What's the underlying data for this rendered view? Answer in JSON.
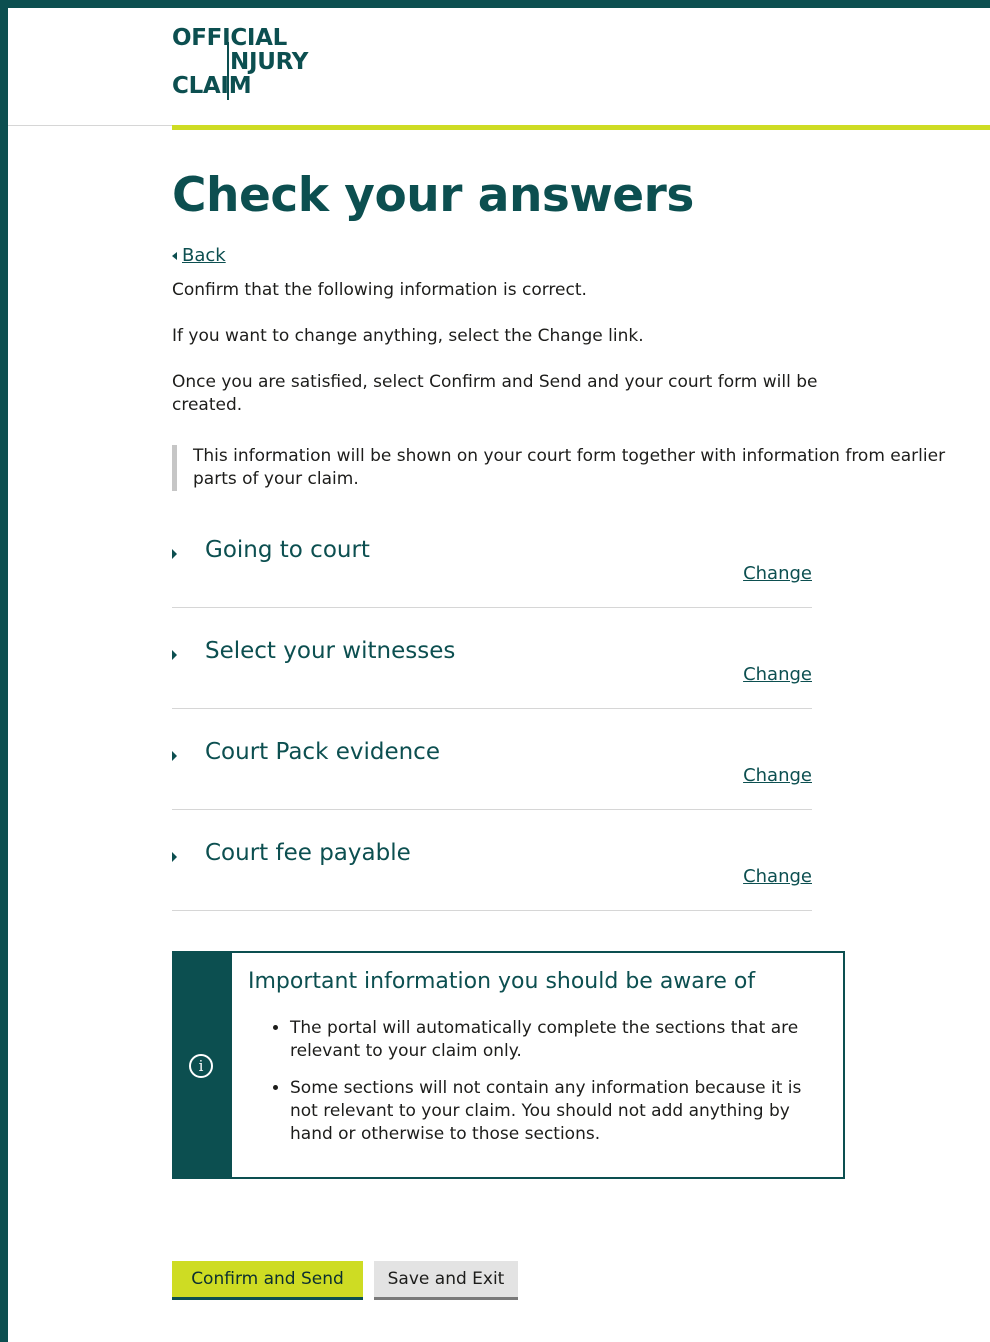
{
  "logo": {
    "line1": "OFFICIAL",
    "line2": "NJURY",
    "line3": "CLAIM"
  },
  "page": {
    "title": "Check your answers",
    "back_label": "Back"
  },
  "intro": {
    "p1": "Confirm that the following information is correct.",
    "p2": "If you want to change anything, select the Change link.",
    "p3": "Once you are satisfied, select Confirm and Send and your court form will be created.",
    "inset": "This information will be shown on your court form together with information from earlier parts of your claim."
  },
  "sections": [
    {
      "title": "Going to court",
      "action": "Change"
    },
    {
      "title": "Select your witnesses",
      "action": "Change"
    },
    {
      "title": "Court Pack evidence",
      "action": "Change"
    },
    {
      "title": "Court fee payable",
      "action": "Change"
    }
  ],
  "info": {
    "icon": "info-icon",
    "title": "Important information you should be aware of",
    "bullets": [
      "The portal will automatically complete the sections that are relevant to your claim only.",
      "Some sections will not contain any information because it is not relevant to your claim. You should not add anything by hand or otherwise to those sections."
    ]
  },
  "buttons": {
    "confirm": "Confirm and Send",
    "save": "Save and Exit"
  },
  "colors": {
    "brand": "#0c4f50",
    "accent": "#cedc23"
  }
}
